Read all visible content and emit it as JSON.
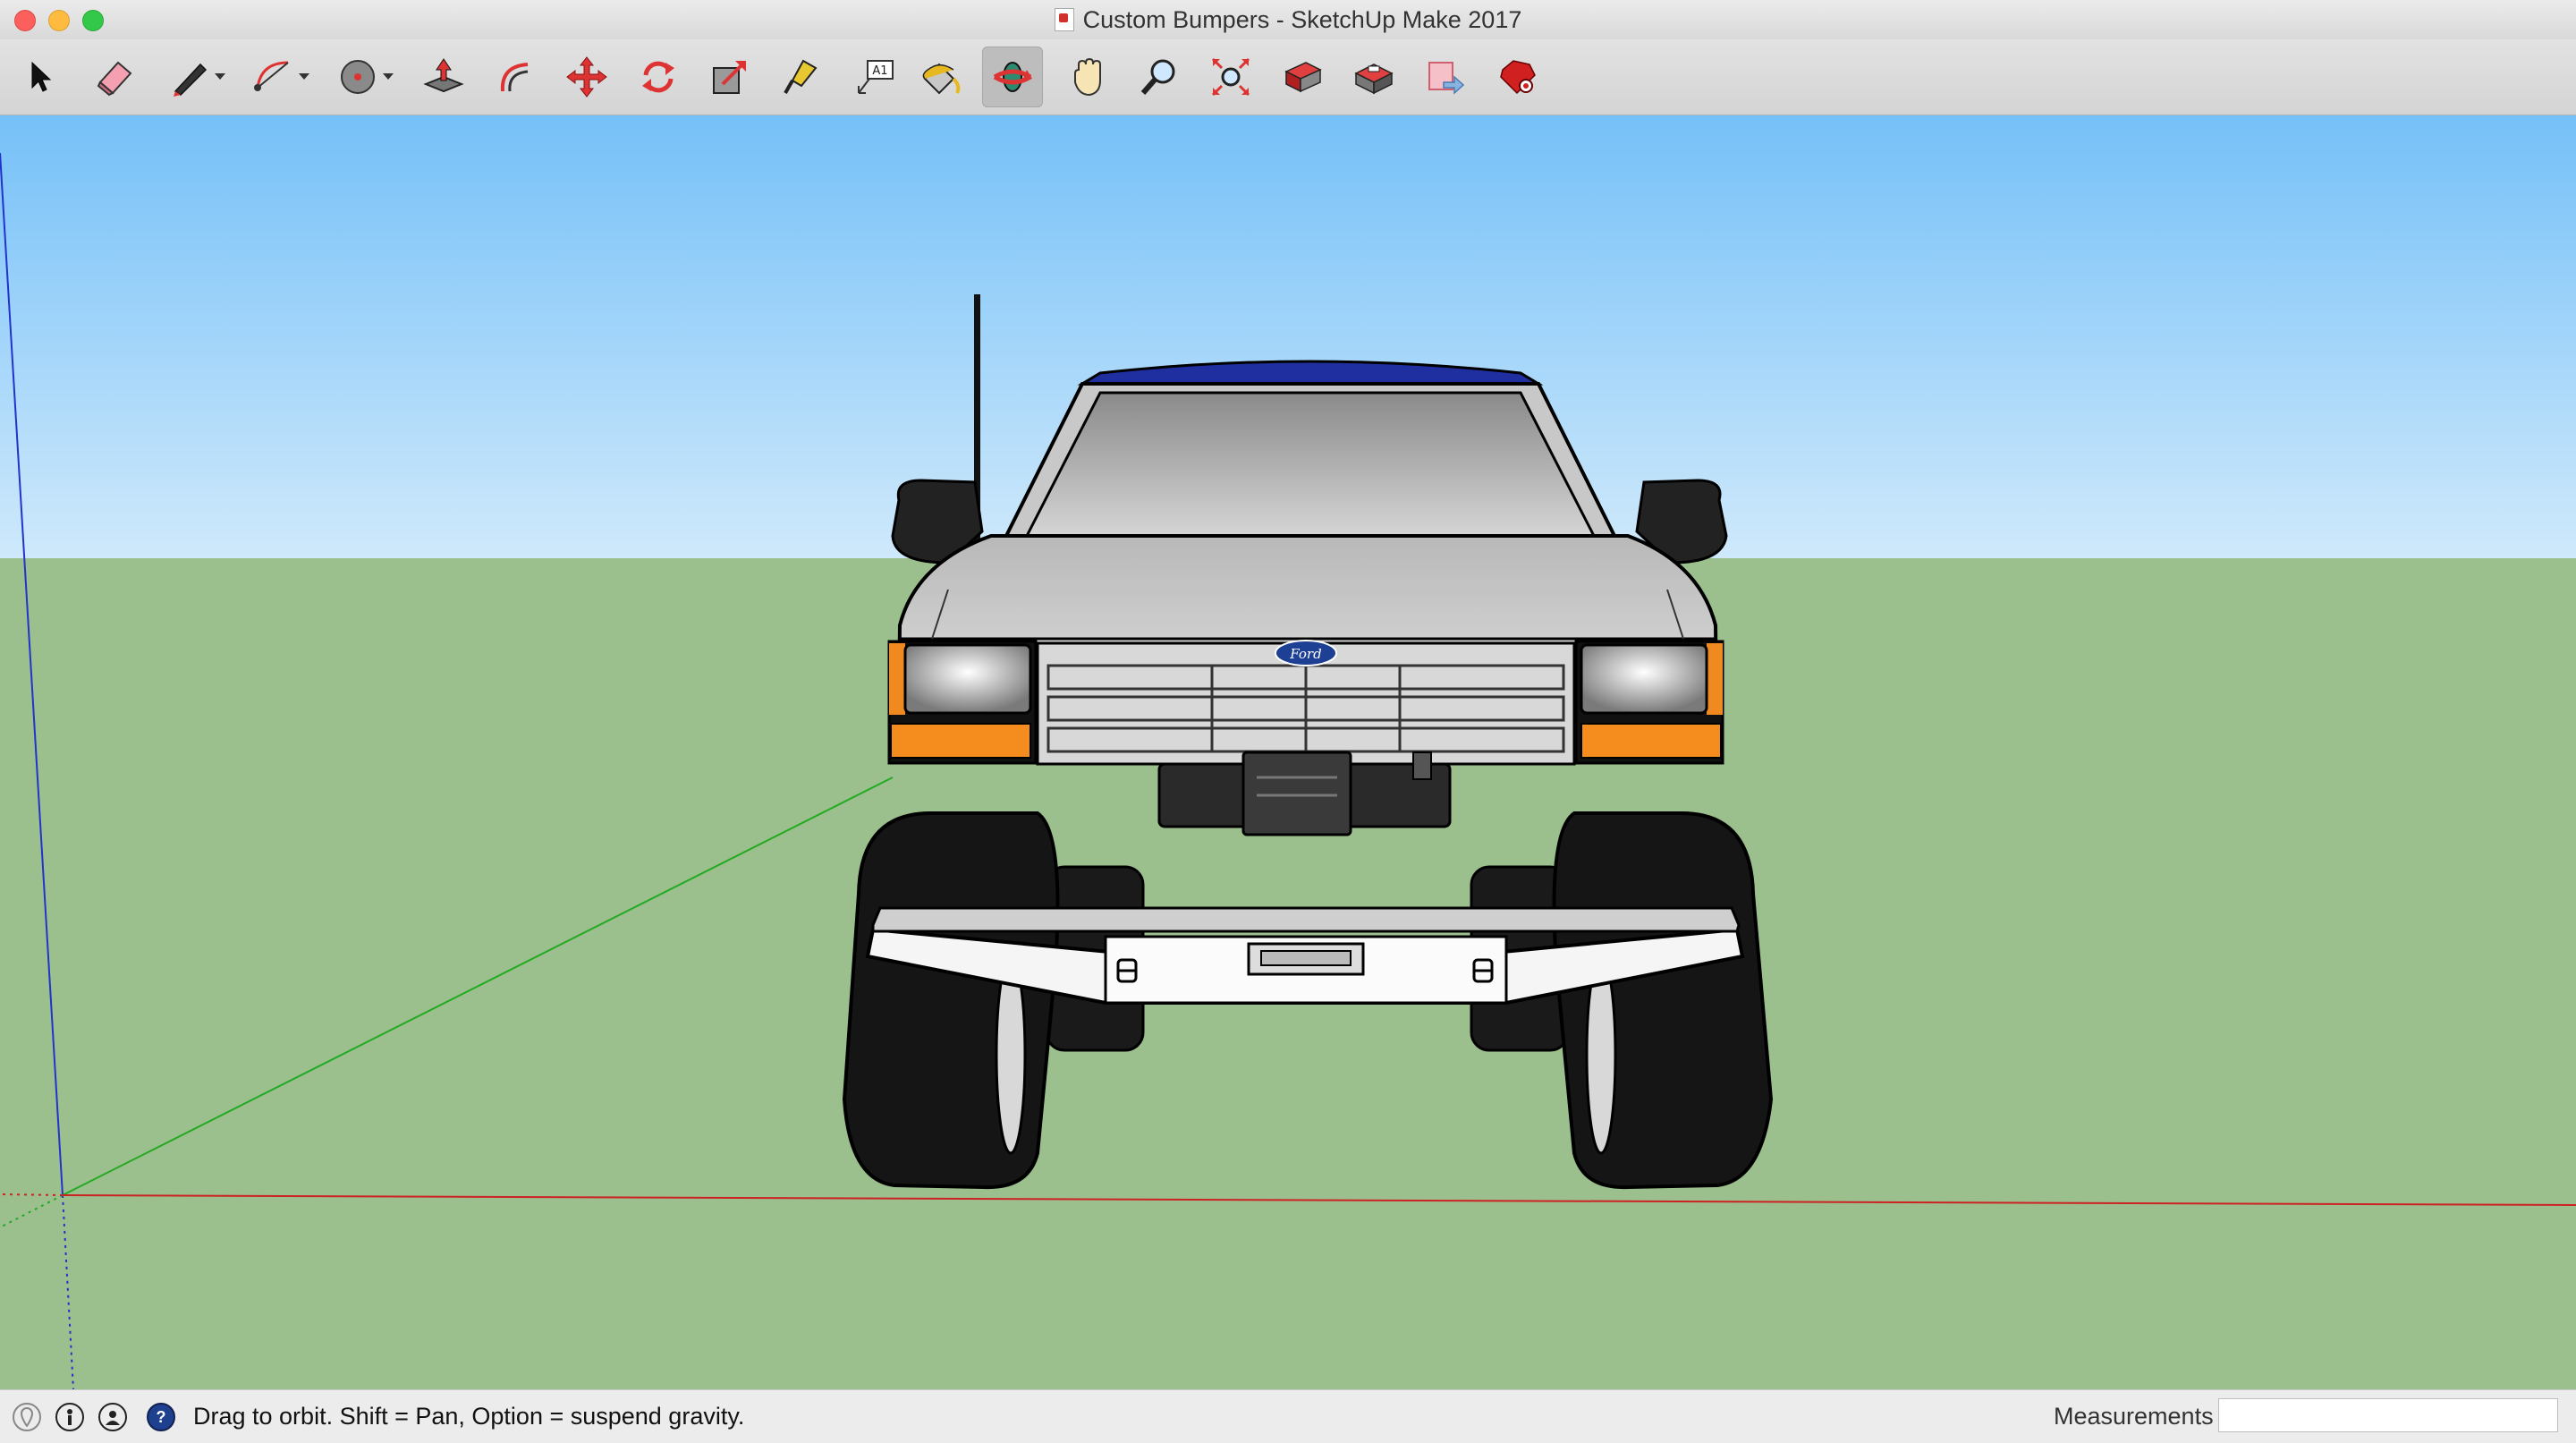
{
  "window": {
    "title": "Custom Bumpers - SketchUp Make 2017"
  },
  "toolbar": {
    "tools": [
      {
        "name": "select-tool-icon"
      },
      {
        "name": "eraser-tool-icon"
      },
      {
        "name": "line-tool-icon"
      },
      {
        "name": "arc-tool-icon"
      },
      {
        "name": "shape-tool-icon"
      },
      {
        "name": "push-pull-tool-icon"
      },
      {
        "name": "offset-tool-icon"
      },
      {
        "name": "move-tool-icon"
      },
      {
        "name": "rotate-tool-icon"
      },
      {
        "name": "scale-tool-icon"
      },
      {
        "name": "tape-measure-tool-icon"
      },
      {
        "name": "text-tool-icon",
        "glyph": "A1"
      },
      {
        "name": "paint-bucket-tool-icon"
      },
      {
        "name": "orbit-tool-icon",
        "active": true
      },
      {
        "name": "pan-tool-icon"
      },
      {
        "name": "zoom-tool-icon"
      },
      {
        "name": "zoom-extents-tool-icon"
      },
      {
        "name": "3d-warehouse-icon"
      },
      {
        "name": "extension-warehouse-icon"
      },
      {
        "name": "send-to-layout-icon"
      },
      {
        "name": "extension-manager-icon"
      }
    ]
  },
  "viewport": {
    "sky_color": "#7ec4f8",
    "ground_color": "#9cbf8e",
    "axes": {
      "red": "#cc2222",
      "green": "#22aa22",
      "blue": "#2233cc"
    },
    "model": {
      "badge_text": "Ford"
    }
  },
  "statusbar": {
    "hint": "Drag to orbit. Shift = Pan, Option = suspend gravity.",
    "measurements_label": "Measurements",
    "measurements_value": ""
  }
}
